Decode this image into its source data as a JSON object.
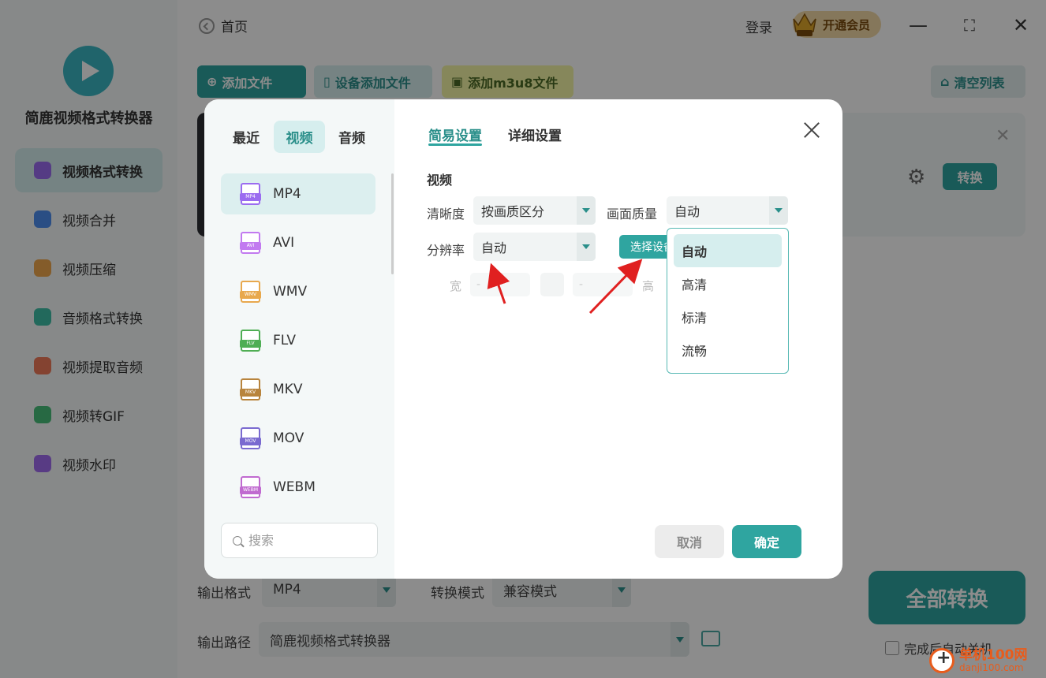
{
  "app": {
    "name": "简鹿视频格式转换器",
    "nav": [
      {
        "label": "视频格式转换",
        "icon": "video-convert-icon",
        "color": "#9b6cf0",
        "active": true
      },
      {
        "label": "视频合并",
        "icon": "video-merge-icon",
        "color": "#4d8ef0"
      },
      {
        "label": "视频压缩",
        "icon": "video-compress-icon",
        "color": "#f0a84d"
      },
      {
        "label": "音频格式转换",
        "icon": "audio-convert-icon",
        "color": "#3fbfa8"
      },
      {
        "label": "视频提取音频",
        "icon": "extract-audio-icon",
        "color": "#f07a5a"
      },
      {
        "label": "视频转GIF",
        "icon": "gif-icon",
        "color": "#48c07a"
      },
      {
        "label": "视频水印",
        "icon": "watermark-icon",
        "color": "#a06cf0"
      }
    ]
  },
  "topbar": {
    "home": "首页",
    "login": "登录",
    "vip": "开通会员",
    "minimize": "—",
    "maximize": "⛶",
    "close": "✕"
  },
  "toolbar": {
    "add_file": "添加文件",
    "add_device": "设备添加文件",
    "add_m3u8": "添加m3u8文件",
    "clear_list": "清空列表"
  },
  "file_card": {
    "convert": "转换"
  },
  "bottom": {
    "output_format_label": "输出格式",
    "output_format": "MP4",
    "convert_mode_label": "转换模式",
    "convert_mode": "兼容模式",
    "output_path_label": "输出路径",
    "output_path": "简鹿视频格式转换器",
    "convert_all": "全部转换",
    "auto_shutdown": "完成后自动关机"
  },
  "modal": {
    "categories": [
      {
        "label": "最近"
      },
      {
        "label": "视频",
        "active": true
      },
      {
        "label": "音频"
      }
    ],
    "formats": [
      {
        "label": "MP4",
        "color": "#9b6cf0",
        "active": true
      },
      {
        "label": "AVI",
        "color": "#c27af0"
      },
      {
        "label": "WMV",
        "color": "#e8a84d"
      },
      {
        "label": "FLV",
        "color": "#4fae54"
      },
      {
        "label": "MKV",
        "color": "#b8843d"
      },
      {
        "label": "MOV",
        "color": "#7a6ad0"
      },
      {
        "label": "WEBM",
        "color": "#c06ad0"
      }
    ],
    "search_placeholder": "搜索",
    "tabs": {
      "simple": "简易设置",
      "detailed": "详细设置"
    },
    "section": "视频",
    "clarity_label": "清晰度",
    "clarity_value": "按画质区分",
    "quality_label": "画面质量",
    "quality_value": "自动",
    "resolution_label": "分辨率",
    "resolution_value": "自动",
    "pick_device": "选择设备",
    "width_label": "宽",
    "height_label": "高",
    "width_value": "-",
    "height_value": "-",
    "quality_options": [
      "自动",
      "高清",
      "标清",
      "流畅"
    ],
    "cancel": "取消",
    "confirm": "确定"
  },
  "watermark": {
    "line1": "单机100网",
    "line2": "danji100.com"
  }
}
